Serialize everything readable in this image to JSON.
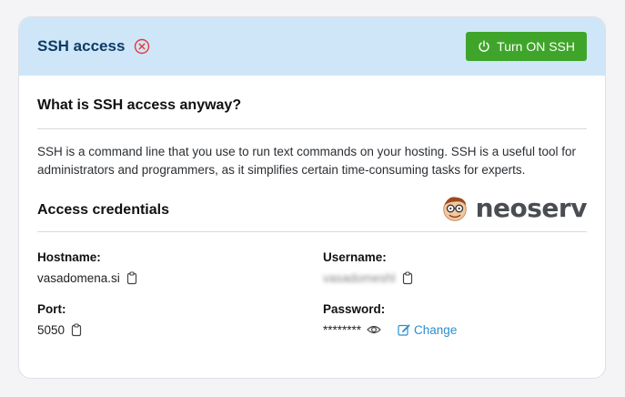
{
  "header": {
    "title": "SSH access",
    "status_icon": "x-circle-icon",
    "status_color": "#e03a3a",
    "button_label": "Turn ON SSH",
    "button_icon": "power-icon",
    "background": "#cfe6f8",
    "button_color": "#3fa52a"
  },
  "about": {
    "title": "What is SSH access anyway?",
    "description": "SSH is a command line that you use to run text commands on your hosting. SSH is a useful tool for administrators and programmers, as it simplifies certain time-consuming tasks for experts."
  },
  "credentials": {
    "title": "Access credentials",
    "logo_text": "neoserv",
    "hostname": {
      "label": "Hostname:",
      "value": "vasadomena.si"
    },
    "username": {
      "label": "Username:",
      "value": "vasadomeshl"
    },
    "port": {
      "label": "Port:",
      "value": "5050"
    },
    "password": {
      "label": "Password:",
      "value": "********",
      "change_label": "Change"
    }
  }
}
